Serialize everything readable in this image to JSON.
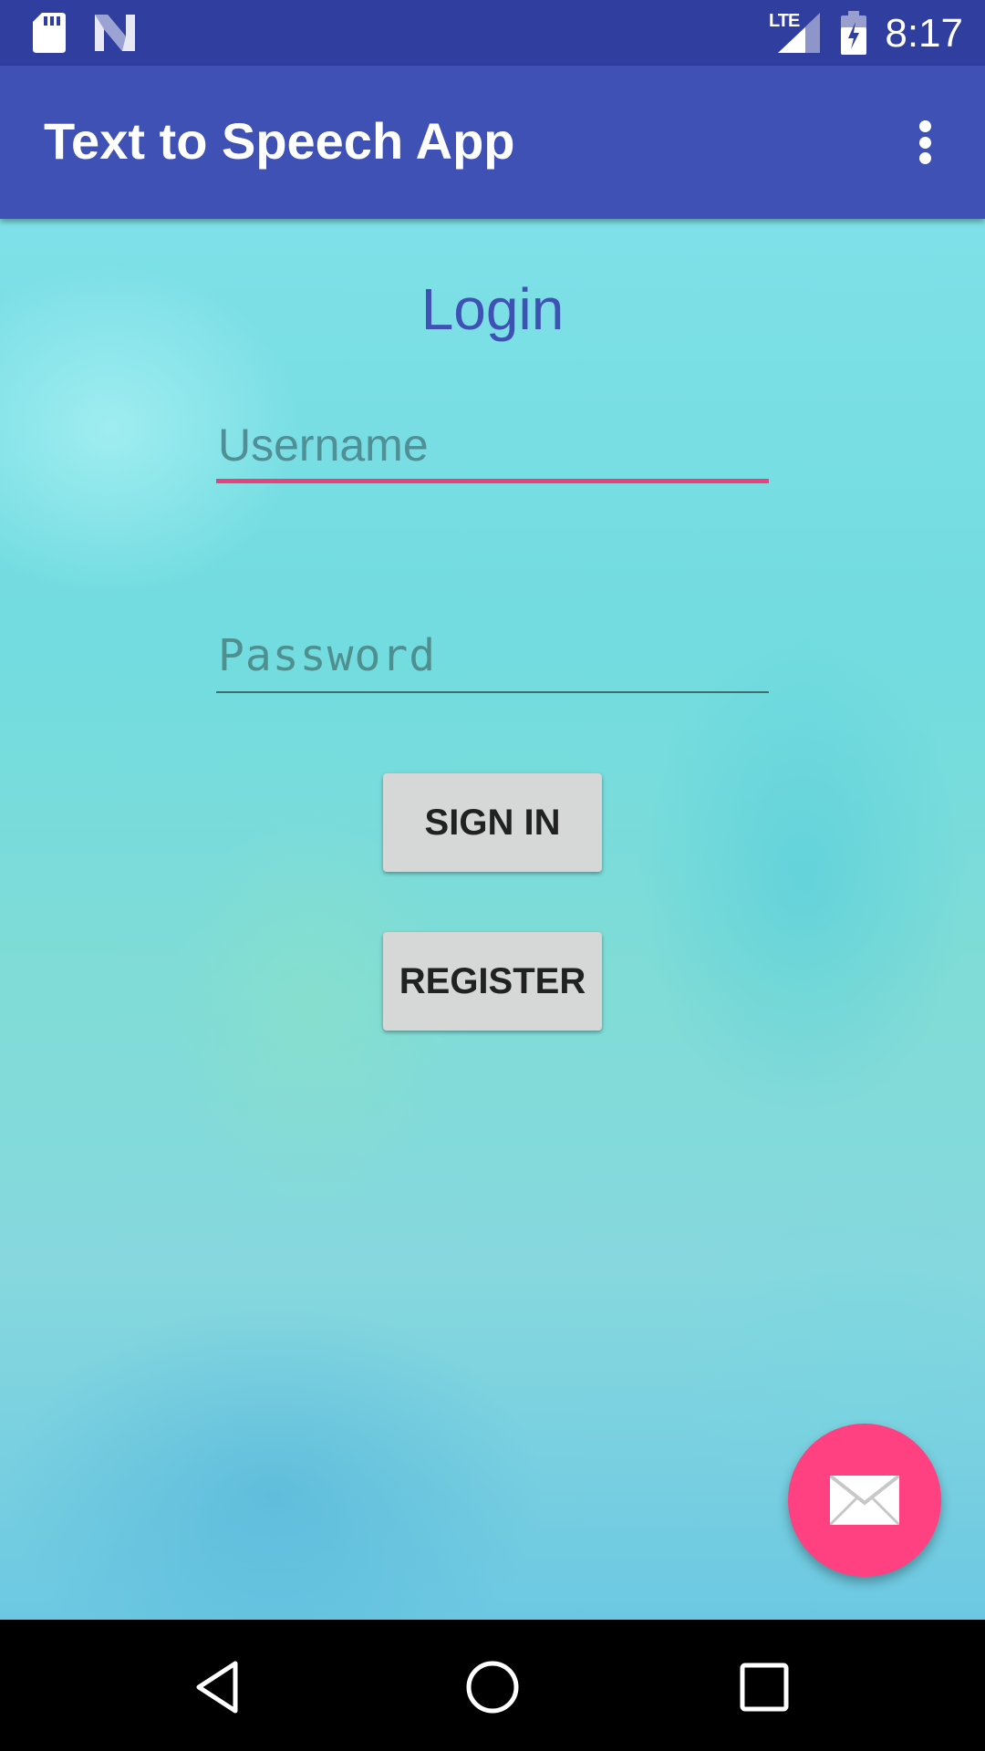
{
  "status_bar": {
    "time": "8:17",
    "network": "LTE",
    "icons": [
      "sd-card-icon",
      "n-notification-icon",
      "signal-icon",
      "battery-icon"
    ]
  },
  "app_bar": {
    "title": "Text to Speech App",
    "overflow_icon": "more-vert-icon"
  },
  "login": {
    "heading": "Login",
    "username_placeholder": "Username",
    "password_placeholder": "Password",
    "sign_in_label": "SIGN IN",
    "register_label": "REGISTER"
  },
  "fab": {
    "icon": "email-icon"
  },
  "nav_bar": {
    "icons": [
      "back-icon",
      "home-icon",
      "recents-icon"
    ]
  },
  "colors": {
    "status_bar": "#303f9f",
    "app_bar": "#3f51b5",
    "accent": "#ff4081",
    "heading": "#3f51b5",
    "button": "#d6d7d7"
  }
}
